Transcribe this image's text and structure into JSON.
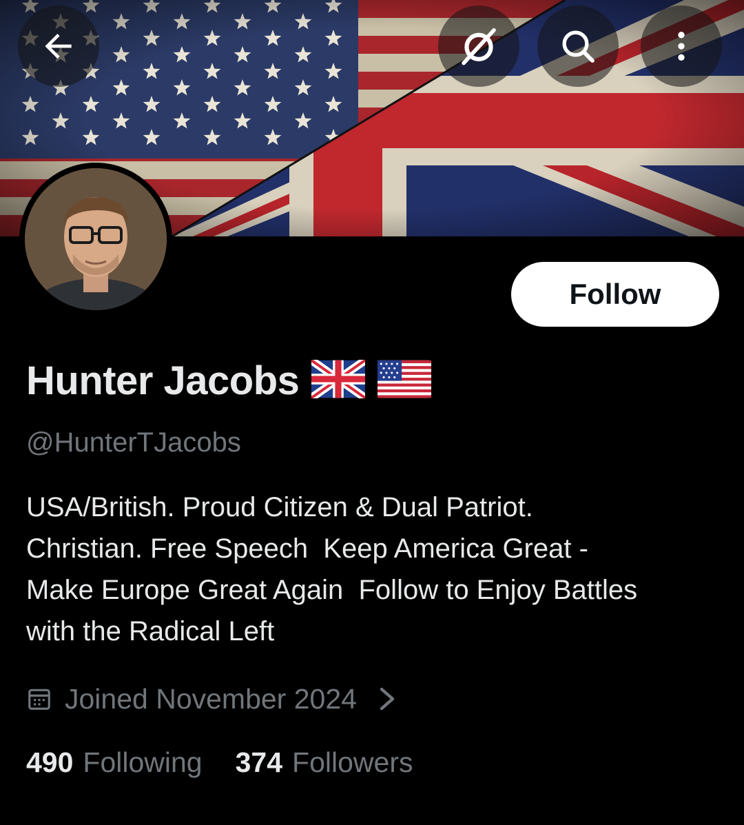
{
  "header": {
    "back_icon": "arrow-left-icon",
    "grok_icon": "grok-icon",
    "search_icon": "search-icon",
    "more_icon": "more-vertical-icon"
  },
  "profile": {
    "name": "Hunter Jacobs",
    "name_flags": [
      "uk-flag-emoji",
      "us-flag-emoji"
    ],
    "handle": "@HunterTJacobs",
    "follow_label": "Follow",
    "bio_lines": [
      "USA/British. Proud Citizen & Dual Patriot.",
      "Christian. Free Speech  Keep America Great -",
      "Make Europe Great Again  Follow to Enjoy Battles",
      "with the Radical Left"
    ],
    "joined": "Joined November 2024",
    "following_count": "490",
    "following_label": "Following",
    "followers_count": "374",
    "followers_label": "Followers"
  },
  "colors": {
    "background": "#000000",
    "primary_text": "#e7e9ea",
    "secondary_text": "#71767b",
    "follow_button_bg": "#ffffff",
    "follow_button_text": "#0f1419"
  }
}
